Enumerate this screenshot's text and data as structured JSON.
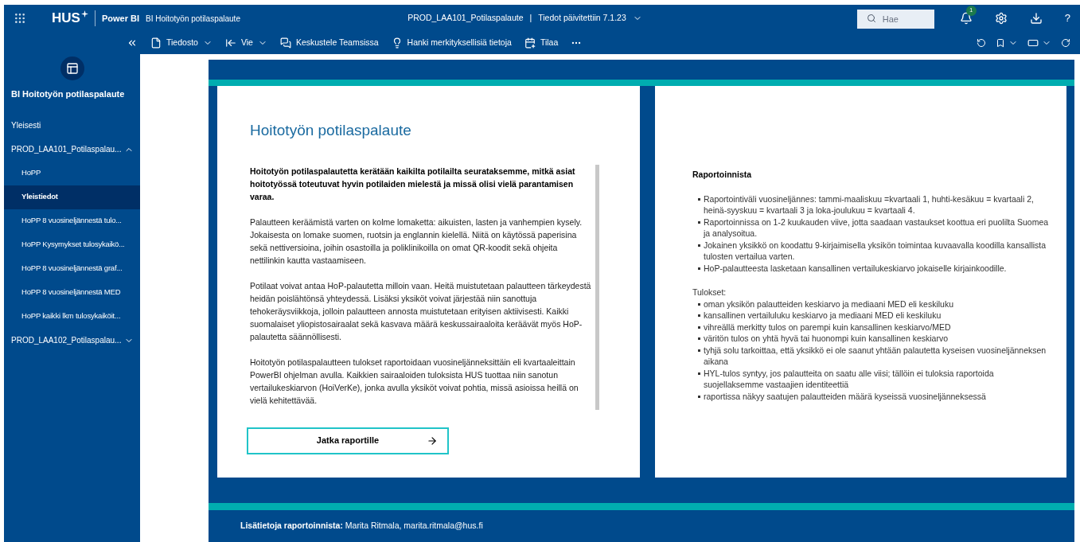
{
  "header": {
    "logo": "HUS",
    "product": "Power BI",
    "report_title": "BI Hoitotyön potilaspalaute",
    "dataset": "PROD_LAA101_Potilaspalaute",
    "separator": "|",
    "updated": "Tiedot päivitettiin 7.1.23",
    "search": {
      "placeholder": "Hae"
    },
    "notification_count": "1",
    "help": "?"
  },
  "toolbar": {
    "items": [
      {
        "label": "Tiedosto",
        "kind": "file",
        "dropdown": true
      },
      {
        "label": "Vie",
        "kind": "export",
        "dropdown": true
      },
      {
        "label": "Keskustele Teamsissa",
        "kind": "teams",
        "dropdown": false
      },
      {
        "label": "Hanki merkityksellisiä tietoja",
        "kind": "insights",
        "dropdown": false
      },
      {
        "label": "Tilaa",
        "kind": "subscribe",
        "dropdown": false
      }
    ]
  },
  "sidebar": {
    "title": "BI Hoitotyön potilaspalaute",
    "items": [
      {
        "label": "Yleisesti",
        "selected": false
      },
      {
        "label": "PROD_LAA101_Potilaspalau...",
        "selected": false,
        "expanded": true,
        "children": [
          {
            "label": "HoPP",
            "selected": false
          },
          {
            "label": "Yleistiedot",
            "selected": true
          },
          {
            "label": "HoPP 8 vuosineljännestä tulo...",
            "selected": false
          },
          {
            "label": "HoPP Kysymykset tulosykaikö...",
            "selected": false
          },
          {
            "label": "HoPP 8 vuosineljännestä graf...",
            "selected": false
          },
          {
            "label": "HoPP 8 vuosineljännestä MED",
            "selected": false
          },
          {
            "label": "HoPP kaikki lkm tulosykaiköit...",
            "selected": false
          }
        ]
      },
      {
        "label": "PROD_LAA102_Potilaspalau...",
        "selected": false,
        "expanded": false
      }
    ]
  },
  "report": {
    "intro_card": {
      "title": "Hoitotyön potilaspalaute",
      "paragraphs": [
        {
          "kind": "lead",
          "text": "Hoitotyön potilaspalautetta kerätään kaikilta potilailta seurataksemme, mitkä asiat hoitotyössä toteutuvat hyvin potilaiden mielestä ja missä olisi vielä parantamisen varaa."
        },
        {
          "kind": "body",
          "text": "Palautteen keräämistä varten on kolme lomaketta: aikuisten, lasten ja vanhempien kysely. Jokaisesta on lomake suomen, ruotsin ja englannin kielellä. Niitä on käytössä paperisina sekä nettiversioina, joihin osastoilla ja poliklinikoilla on omat QR-koodit sekä ohjeita nettilinkin kautta vastaamiseen."
        },
        {
          "kind": "body",
          "text": "Potilaat voivat antaa HoP-palautetta milloin vaan. Heitä muistutetaan palautteen tärkeydestä heidän poislähtönsä yhteydessä. Lisäksi yksiköt voivat järjestää niin sanottuja tehokeräysviikkoja, jolloin palautteen annosta muistutetaan erityisen aktiivisesti. Kaikki suomalaiset yliopistosairaalat sekä kasvava määrä keskussairaaloita keräävät myös HoP-palautetta säännöllisesti."
        },
        {
          "kind": "body",
          "text": "Hoitotyön potilaspalautteen tulokset raportoidaan vuosineljänneksittäin eli kvartaaleittain PowerBI ohjelman avulla. Kaikkien sairaaloiden tuloksista HUS tuottaa niin sanotun vertailukeskiarvon (HoiVerKe), jonka avulla yksiköt voivat pohtia, missä asioissa heillä on vielä kehitettävää."
        }
      ],
      "button": "Jatka raportille"
    },
    "info_card": {
      "title": "Raportoinnista",
      "bullets": [
        "Raportointiväli vuosineljännes: tammi-maaliskuu =kvartaali 1, huhti-kesäkuu = kvartaali 2, heinä-syyskuu = kvartaali 3 ja loka-joulukuu = kvartaali 4.",
        "Raportoinnissa on 1-2 kuukauden viive, jotta saadaan vastaukset koottua eri puolilta Suomea ja analysoitua.",
        "Jokainen yksikkö on koodattu 9-kirjaimisella yksikön toimintaa kuvaavalla koodilla kansallista tulosten vertailua varten.",
        "HoP-palautteesta lasketaan kansallinen vertailukeskiarvo jokaiselle kirjainkoodille."
      ],
      "results_label": "Tulokset:",
      "results": [
        "oman yksikön palautteiden keskiarvo ja mediaani MED eli keskiluku",
        "kansallinen vertailuluku keskiarvo ja mediaani MED eli keskiluku",
        "vihreällä merkitty tulos on parempi kuin kansallinen keskiarvo/MED",
        "väritön tulos on yhtä hyvä tai huonompi kuin kansallinen keskiarvo",
        "tyhjä solu tarkoittaa, että yksikkö ei ole saanut yhtään palautetta kyseisen vuosineljänneksen aikana",
        "HYL-tulos syntyy, jos palautteita on saatu alle viisi; tällöin ei tuloksia raportoida suojellaksemme vastaajien identiteettiä",
        "raportissa näkyy saatujen palautteiden määrä kyseissä vuosineljänneksessä"
      ]
    },
    "footer": "**Lisätietoja raportoinnista:** Marita Ritmala, marita.ritmala@hus.fi"
  }
}
